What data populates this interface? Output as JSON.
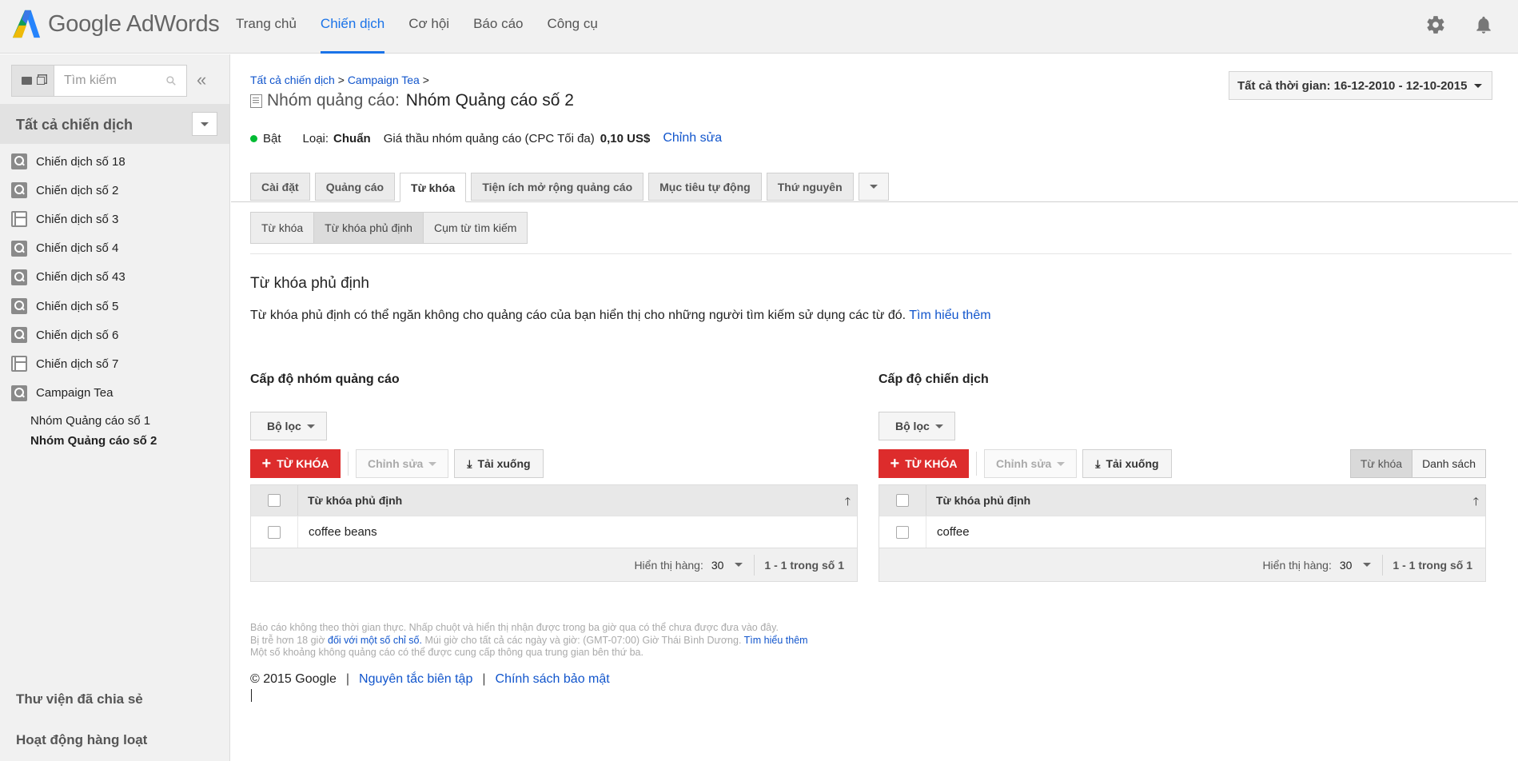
{
  "app": {
    "logo_text": "Google AdWords"
  },
  "nav": {
    "items": [
      "Trang chủ",
      "Chiến dịch",
      "Cơ hội",
      "Báo cáo",
      "Công cụ"
    ],
    "active_index": 1
  },
  "sidebar": {
    "search_placeholder": "Tìm kiếm",
    "all_campaigns": "Tất cả chiến dịch",
    "campaigns": [
      {
        "label": "Chiến dịch số 18",
        "icon": "search-display-icon"
      },
      {
        "label": "Chiến dịch số 2",
        "icon": "search-display-icon"
      },
      {
        "label": "Chiến dịch số 3",
        "icon": "display-grid-icon"
      },
      {
        "label": "Chiến dịch số 4",
        "icon": "search-icon"
      },
      {
        "label": "Chiến dịch số 43",
        "icon": "search-icon"
      },
      {
        "label": "Chiến dịch số 5",
        "icon": "search-display-icon"
      },
      {
        "label": "Chiến dịch số 6",
        "icon": "search-icon"
      },
      {
        "label": "Chiến dịch số 7",
        "icon": "display-grid-icon"
      },
      {
        "label": "Campaign Tea",
        "icon": "search-icon"
      }
    ],
    "ad_groups": [
      {
        "label": "Nhóm Quảng cáo số 1",
        "active": false
      },
      {
        "label": "Nhóm Quảng cáo số 2",
        "active": true
      }
    ],
    "shared_library": "Thư viện đã chia sẻ",
    "bulk_operations": "Hoạt động hàng loạt"
  },
  "main": {
    "breadcrumb": {
      "root": "Tất cả chiến dịch",
      "sep1": ">",
      "campaign": "Campaign Tea",
      "sep2": ">"
    },
    "title_prefix": "Nhóm quảng cáo:",
    "title_name": "Nhóm Quảng cáo số 2",
    "date_range": "Tất cả thời gian: 16-12-2010 - 12-10-2015",
    "status": {
      "state": "Bật",
      "type_label": "Loại:",
      "type_value": "Chuẩn",
      "bid_label": "Giá thầu nhóm quảng cáo (CPC Tối đa)",
      "bid_value": "0,10 US$",
      "edit_link": "Chỉnh sửa"
    },
    "tabs": [
      "Cài đặt",
      "Quảng cáo",
      "Từ khóa",
      "Tiện ích mở rộng quảng cáo",
      "Mục tiêu tự động",
      "Thứ nguyên"
    ],
    "active_tab": 2,
    "subtabs": [
      "Từ khóa",
      "Từ khóa phủ định",
      "Cụm từ tìm kiếm"
    ],
    "active_subtab": 1,
    "section_title": "Từ khóa phủ định",
    "section_desc": "Từ khóa phủ định có thể ngăn không cho quảng cáo của bạn hiển thị cho những người tìm kiếm sử dụng các từ đó.",
    "learn_more": "Tìm hiểu thêm"
  },
  "panels": {
    "adgroup": {
      "title": "Cấp độ nhóm quảng cáo",
      "filter": "Bộ lọc",
      "add_keyword": "TỪ KHÓA",
      "edit": "Chỉnh sửa",
      "download": "Tải xuống",
      "column": "Từ khóa phủ định",
      "rows": [
        "coffee beans"
      ],
      "rows_label": "Hiển thị hàng:",
      "rows_value": "30",
      "range": "1 - 1 trong số 1"
    },
    "campaign": {
      "title": "Cấp độ chiến dịch",
      "filter": "Bộ lọc",
      "add_keyword": "TỪ KHÓA",
      "edit": "Chỉnh sửa",
      "download": "Tải xuống",
      "toggle": [
        "Từ khóa",
        "Danh sách"
      ],
      "column": "Từ khóa phủ định",
      "rows": [
        "coffee"
      ],
      "rows_label": "Hiển thị hàng:",
      "rows_value": "30",
      "range": "1 - 1 trong số 1"
    }
  },
  "footer": {
    "note_line1": "Báo cáo không theo thời gian thực. Nhấp chuột và hiển thị nhận được trong ba giờ qua có thể chưa được đưa vào đây.",
    "note_line2_a": "Bị trễ hơn 18 giờ",
    "note_line2_link": "đối với một số chỉ số.",
    "note_line2_b": "Múi giờ cho tất cả các ngày và giờ: (GMT-07:00) Giờ Thái Bình Dương.",
    "note_line2_link2": "Tìm hiểu thêm",
    "note_line3": "Một số khoảng không quảng cáo có thể được cung cấp thông qua trung gian bên thứ ba.",
    "copyright": "© 2015 Google",
    "sep": "|",
    "editorial": "Nguyên tắc biên tập",
    "privacy": "Chính sách bảo mật"
  },
  "colors": {
    "accent": "#1a73e8",
    "red_button": "#dd2c2c",
    "status_on": "#00bb33",
    "link": "#1155cc"
  }
}
